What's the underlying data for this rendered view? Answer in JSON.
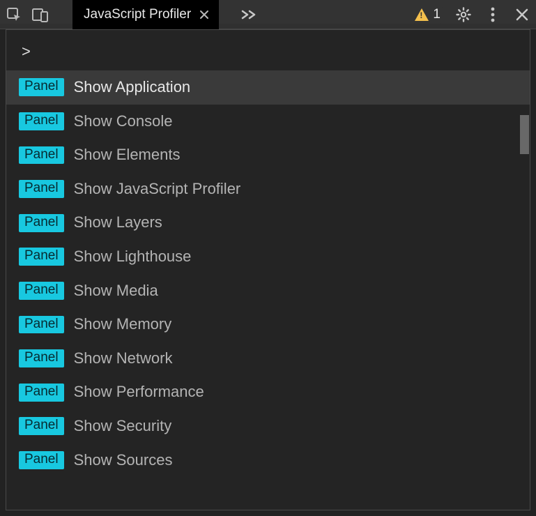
{
  "toolbar": {
    "active_tab": "JavaScript Profiler",
    "warning_count": "1"
  },
  "command_menu": {
    "prompt": ">",
    "badge_label": "Panel",
    "items": [
      {
        "label": "Show Application",
        "selected": true
      },
      {
        "label": "Show Console",
        "selected": false
      },
      {
        "label": "Show Elements",
        "selected": false
      },
      {
        "label": "Show JavaScript Profiler",
        "selected": false
      },
      {
        "label": "Show Layers",
        "selected": false
      },
      {
        "label": "Show Lighthouse",
        "selected": false
      },
      {
        "label": "Show Media",
        "selected": false
      },
      {
        "label": "Show Memory",
        "selected": false
      },
      {
        "label": "Show Network",
        "selected": false
      },
      {
        "label": "Show Performance",
        "selected": false
      },
      {
        "label": "Show Security",
        "selected": false
      },
      {
        "label": "Show Sources",
        "selected": false
      }
    ]
  }
}
